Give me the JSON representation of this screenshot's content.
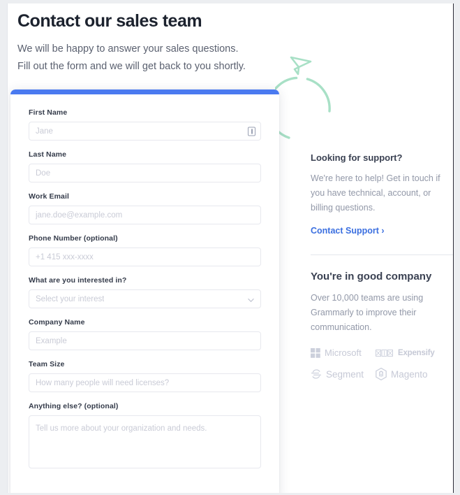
{
  "header": {
    "title": "Contact our sales team",
    "subtitle_line1": "We will be happy to answer your sales questions.",
    "subtitle_line2": "Fill out the form and we will get back to you shortly."
  },
  "form": {
    "accent_color": "#4a7af0",
    "fields": [
      {
        "label": "First Name",
        "placeholder": "Jane",
        "type": "text",
        "has_autofill_icon": true
      },
      {
        "label": "Last Name",
        "placeholder": "Doe",
        "type": "text"
      },
      {
        "label": "Work Email",
        "placeholder": "jane.doe@example.com",
        "type": "email"
      },
      {
        "label": "Phone Number (optional)",
        "placeholder": "+1 415 xxx-xxxx",
        "type": "tel"
      },
      {
        "label": "What are you interested in?",
        "placeholder": "Select your interest",
        "type": "select"
      },
      {
        "label": "Company Name",
        "placeholder": "Example",
        "type": "text"
      },
      {
        "label": "Team Size",
        "placeholder": "How many people will need licenses?",
        "type": "text"
      },
      {
        "label": "Anything else? (optional)",
        "placeholder": "Tell us more about your organization and needs.",
        "type": "textarea"
      }
    ]
  },
  "sidebar": {
    "support": {
      "heading": "Looking for support?",
      "body": "We're here to help! Get in touch if you have technical, account, or billing questions.",
      "link_label": "Contact Support ›",
      "link_color": "#3b6fe0"
    },
    "company": {
      "heading": "You're in good company",
      "body": "Over 10,000 teams are using Grammarly to improve their communication.",
      "logos": [
        {
          "name": "Microsoft",
          "icon": "microsoft-logo-icon"
        },
        {
          "name": "Expensify",
          "icon": "expensify-logo-icon"
        },
        {
          "name": "Segment",
          "icon": "segment-logo-icon"
        },
        {
          "name": "Magento",
          "icon": "magento-logo-icon"
        }
      ]
    }
  },
  "decoration": {
    "cursor_icon": "paper-plane-cursor-icon",
    "arc_icon": "circular-arc-icon",
    "accent_color": "#a8e0c6"
  }
}
